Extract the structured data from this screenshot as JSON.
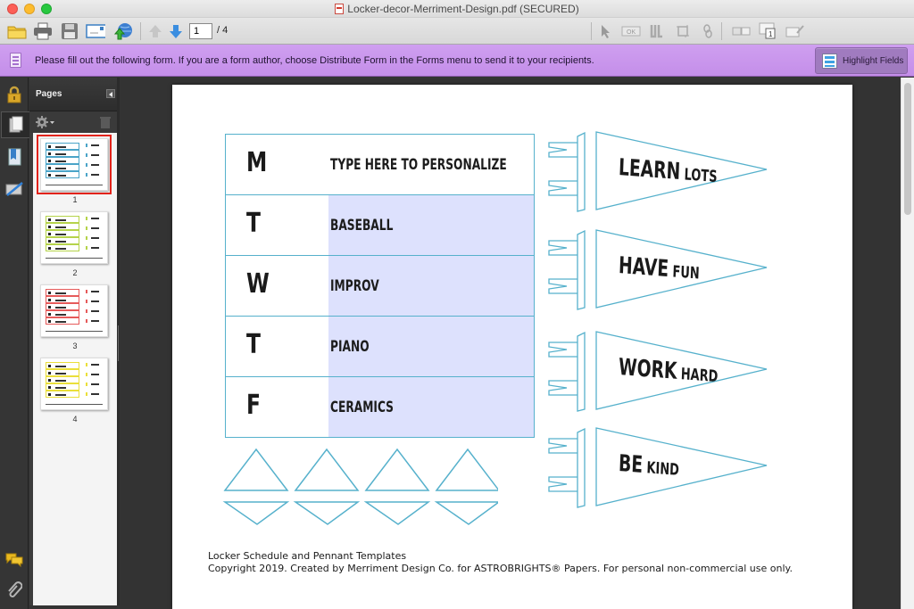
{
  "window": {
    "title": "Locker-decor-Merriment-Design.pdf (SECURED)"
  },
  "toolbar": {
    "buttons_left": [
      "open-folder",
      "print",
      "save",
      "email",
      "share-web"
    ],
    "prev_page": "previous-page",
    "next_page": "next-page",
    "current_page": "1",
    "total_pages": "/ 4",
    "buttons_right": [
      "select-tool",
      "ok-button-tool",
      "text-field-tool",
      "crop-tool",
      "link-tool",
      "form-field-1",
      "form-field-2",
      "form-field-3"
    ]
  },
  "formsbar": {
    "message": "Please fill out the following form. If you are a form author, choose Distribute Form in the Forms menu to send it to your recipients.",
    "highlight_label": "Highlight Fields",
    "color": "#c996ec"
  },
  "rail": {
    "items": [
      "security",
      "pages",
      "bookmarks",
      "signatures"
    ],
    "bottom_items": [
      "comments",
      "attachments"
    ]
  },
  "pages_panel": {
    "title": "Pages",
    "thumbnails": [
      {
        "number": "1",
        "color": "#4aa4c8",
        "selected": true
      },
      {
        "number": "2",
        "color": "#b5d34a",
        "selected": false
      },
      {
        "number": "3",
        "color": "#e65a5a",
        "selected": false
      },
      {
        "number": "4",
        "color": "#eadf3a",
        "selected": false
      }
    ]
  },
  "document": {
    "accent_color": "#56b1cc",
    "schedule": [
      {
        "day": "M",
        "activity": "TYPE HERE TO PERSONALIZE"
      },
      {
        "day": "T",
        "activity": "BASEBALL"
      },
      {
        "day": "W",
        "activity": "IMPROV"
      },
      {
        "day": "T",
        "activity": "PIANO"
      },
      {
        "day": "F",
        "activity": "CERAMICS"
      }
    ],
    "pennants": [
      {
        "big": "LEARN",
        "small": " LOTS"
      },
      {
        "big": "HAVE",
        "small": " FUN"
      },
      {
        "big": "WORK",
        "small": " HARD"
      },
      {
        "big": "BE",
        "small": " KIND"
      }
    ],
    "footer_title": "Locker Schedule and Pennant Templates",
    "footer_copyright": "Copyright 2019. Created by Merriment Design Co. for ASTROBRIGHTS® Papers. For personal non-commercial use only."
  }
}
